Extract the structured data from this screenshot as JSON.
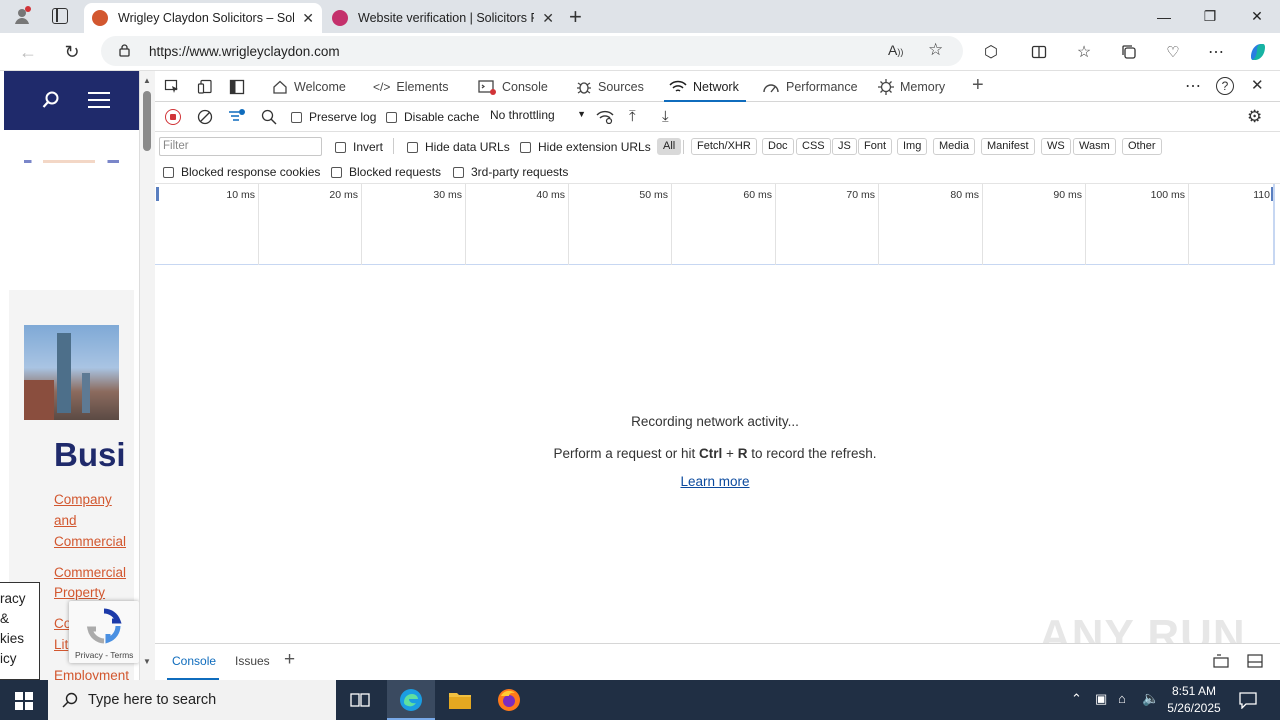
{
  "browser": {
    "tabs": [
      {
        "title": "Wrigley Claydon Solicitors – Solic",
        "active": true
      },
      {
        "title": "Website verification | Solicitors Re",
        "active": false
      }
    ],
    "url": "https://www.wrigleyclaydon.com"
  },
  "page": {
    "heading": "Busi",
    "links": [
      "Company",
      "and",
      "Commercial",
      "Commercial",
      "Property",
      "Co",
      "Lit",
      "Employment"
    ],
    "cookie_fragments": [
      "racy",
      "&",
      "kies",
      "icy"
    ],
    "recaptcha_terms": "Privacy - Terms"
  },
  "devtools": {
    "tabs": [
      "Welcome",
      "Elements",
      "Console",
      "Sources",
      "Network",
      "Performance",
      "Memory"
    ],
    "active_tab": "Network",
    "toolbar": {
      "preserve_log": "Preserve log",
      "disable_cache": "Disable cache",
      "throttling": "No throttling"
    },
    "filter_placeholder": "Filter",
    "options": {
      "invert": "Invert",
      "hide_data_urls": "Hide data URLs",
      "hide_extension_urls": "Hide extension URLs",
      "blocked_response_cookies": "Blocked response cookies",
      "blocked_requests": "Blocked requests",
      "third_party": "3rd-party requests"
    },
    "type_filters": [
      "All",
      "Fetch/XHR",
      "Doc",
      "CSS",
      "JS",
      "Font",
      "Img",
      "Media",
      "Manifest",
      "WS",
      "Wasm",
      "Other"
    ],
    "timeline_ticks": [
      "10 ms",
      "20 ms",
      "30 ms",
      "40 ms",
      "50 ms",
      "60 ms",
      "70 ms",
      "80 ms",
      "90 ms",
      "100 ms",
      "110"
    ],
    "empty": {
      "line1": "Recording network activity...",
      "line2_pre": "Perform a request or hit ",
      "line2_key1": "Ctrl",
      "line2_plus": " + ",
      "line2_key2": "R",
      "line2_post": " to record the refresh.",
      "learn_more": "Learn more"
    },
    "drawer_tabs": [
      "Console",
      "Issues"
    ]
  },
  "watermark": "ANY RUN",
  "taskbar": {
    "search_placeholder": "Type here to search",
    "time": "8:51 AM",
    "date": "5/26/2025"
  },
  "colors": {
    "accent": "#0f6cbd",
    "site_header": "#1f2a6b",
    "link": "#d2572f",
    "taskbar": "#202f44"
  }
}
